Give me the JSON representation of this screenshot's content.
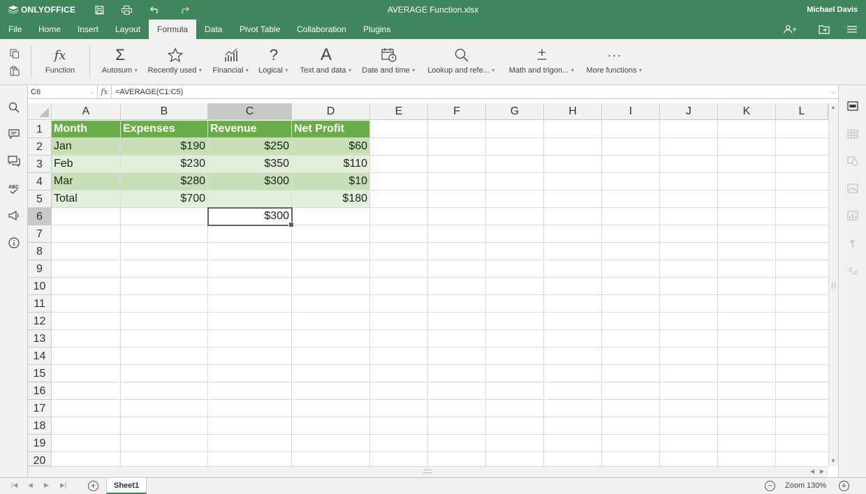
{
  "app": {
    "brand": "ONLYOFFICE",
    "doc_title": "AVERAGE Function.xlsx",
    "user": "Michael Davis",
    "accent": "#40865c"
  },
  "tabs": [
    {
      "label": "File"
    },
    {
      "label": "Home"
    },
    {
      "label": "Insert"
    },
    {
      "label": "Layout"
    },
    {
      "label": "Formula"
    },
    {
      "label": "Data"
    },
    {
      "label": "Pivot Table"
    },
    {
      "label": "Collaboration"
    },
    {
      "label": "Plugins"
    }
  ],
  "toolbar": {
    "function": "Function",
    "autosum": "Autosum",
    "recently_used": "Recently used",
    "financial": "Financial",
    "logical": "Logical",
    "text_data": "Text and data",
    "date_time": "Date and time",
    "lookup": "Lookup and refe...",
    "math": "Math and trigon...",
    "more": "More functions"
  },
  "formula_bar": {
    "cell_ref": "C6",
    "fx": "fx",
    "formula": "=AVERAGE(C1:C5)"
  },
  "columns": [
    "A",
    "B",
    "C",
    "D",
    "E",
    "F",
    "G",
    "H",
    "I",
    "J",
    "K",
    "L"
  ],
  "rows": [
    "1",
    "2",
    "3",
    "4",
    "5",
    "6",
    "7",
    "8",
    "9",
    "10",
    "11",
    "12",
    "13",
    "14",
    "15",
    "16",
    "17",
    "18",
    "19",
    "20"
  ],
  "cells": {
    "header": [
      "Month",
      "Expenses",
      "Revenue",
      "Net Profit"
    ],
    "r2": [
      "Jan",
      "$190",
      "$250",
      "$60"
    ],
    "r3": [
      "Feb",
      "$230",
      "$350",
      "$110"
    ],
    "r4": [
      "Mar",
      "$280",
      "$300",
      "$10"
    ],
    "r5": [
      "Total",
      "$700",
      "",
      "$180"
    ],
    "c6": "$300"
  },
  "sheets": [
    {
      "name": "Sheet1"
    }
  ],
  "zoom": "Zoom 130%",
  "colors": {
    "header_fill": "#6aac45",
    "row_dark": "#c5e0b4",
    "row_light": "#e2efda"
  }
}
